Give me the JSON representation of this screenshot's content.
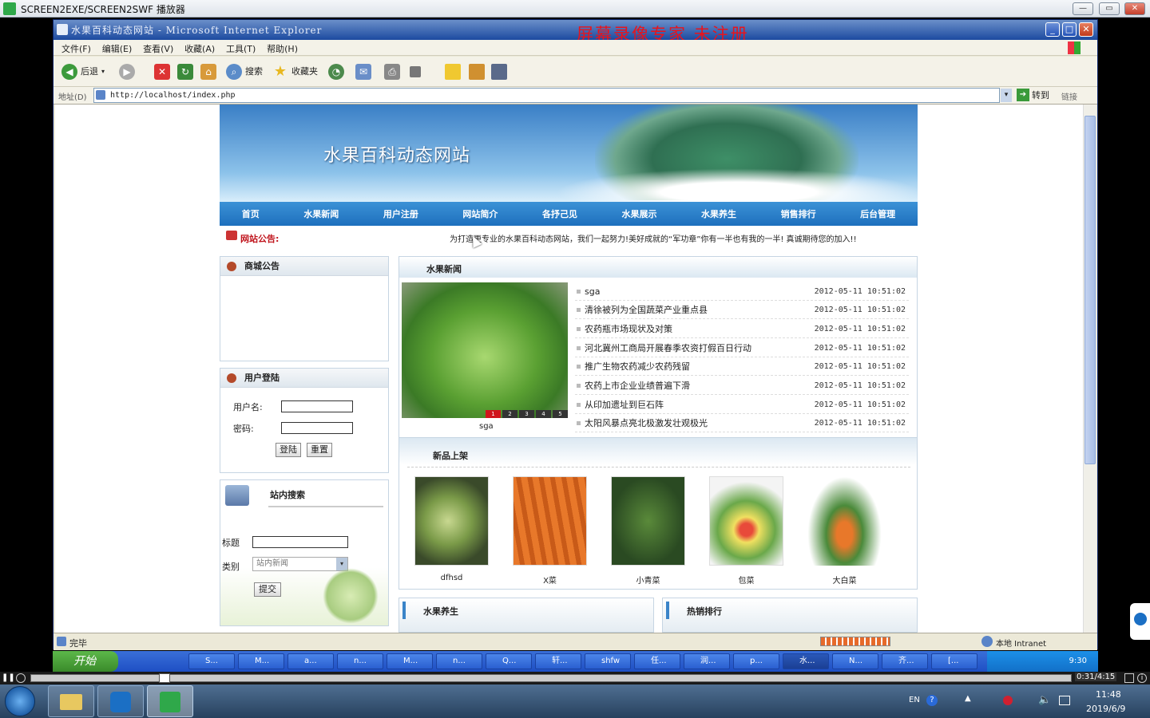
{
  "player": {
    "title": "SCREEN2EXE/SCREEN2SWF 播放器",
    "time": "0:31/4:15"
  },
  "ie": {
    "title": "水果百科动态网站 - Microsoft Internet Explorer",
    "watermark": "屏幕录像专家  未注册",
    "menu": [
      "文件(F)",
      "编辑(E)",
      "查看(V)",
      "收藏(A)",
      "工具(T)",
      "帮助(H)"
    ],
    "toolbar": {
      "back": "后退",
      "search": "搜索",
      "favorites": "收藏夹"
    },
    "address_label": "地址(D)",
    "address": "http://localhost/index.php",
    "go": "转到",
    "links": "链接",
    "status": "完毕",
    "zone": "本地 Intranet"
  },
  "site": {
    "title": "水果百科动态网站",
    "nav": [
      "首页",
      "水果新闻",
      "用户注册",
      "网站简介",
      "各抒己见",
      "水果展示",
      "水果养生",
      "销售排行",
      "后台管理"
    ],
    "notice_label": "网站公告:",
    "notice_text": "为打造更专业的水果百科动态网站，我们一起努力!美好成就的“军功章”你有一半也有我的一半! 真诚期待您的加入!!",
    "mall_notice": "商城公告",
    "login": {
      "title": "用户登陆",
      "username": "用户名:",
      "password": "密码:",
      "login_btn": "登陆",
      "reset_btn": "重置"
    },
    "search": {
      "title": "站内搜索",
      "title_label": "标题",
      "category_label": "类别",
      "category_value": "站内新闻",
      "submit": "提交"
    },
    "news": {
      "title": "水果新闻",
      "caption": "sga",
      "pages": [
        "1",
        "2",
        "3",
        "4",
        "5"
      ],
      "items": [
        {
          "title": "sga",
          "date": "2012-05-11 10:51:02"
        },
        {
          "title": "清徐被列为全国蔬菜产业重点县",
          "date": "2012-05-11 10:51:02"
        },
        {
          "title": "农药瓶市场现状及对策",
          "date": "2012-05-11 10:51:02"
        },
        {
          "title": "河北冀州工商局开展春季农资打假百日行动",
          "date": "2012-05-11 10:51:02"
        },
        {
          "title": "推广生物农药减少农药残留",
          "date": "2012-05-11 10:51:02"
        },
        {
          "title": "农药上市企业业绩普遍下滑",
          "date": "2012-05-11 10:51:02"
        },
        {
          "title": "从印加遗址到巨石阵",
          "date": "2012-05-11 10:51:02"
        },
        {
          "title": "太阳风暴点亮北极激发壮观极光",
          "date": "2012-05-11 10:51:02"
        }
      ]
    },
    "new_products": {
      "title": "新品上架",
      "items": [
        "dfhsd",
        "X菜",
        "小青菜",
        "包菜",
        "大白菜"
      ]
    },
    "health": "水果养生",
    "hot": "热销排行"
  },
  "xp_taskbar": {
    "start": "开始",
    "tasks": [
      "S...",
      "M...",
      "a...",
      "n...",
      "M...",
      "n...",
      "Q...",
      "轩...",
      "shfw",
      "任...",
      "润...",
      "p...",
      "水...",
      "N...",
      "齐...",
      "[..."
    ],
    "clock": "9:30"
  },
  "win7": {
    "lang": "EN",
    "time": "11:48",
    "date": "2019/6/9"
  }
}
